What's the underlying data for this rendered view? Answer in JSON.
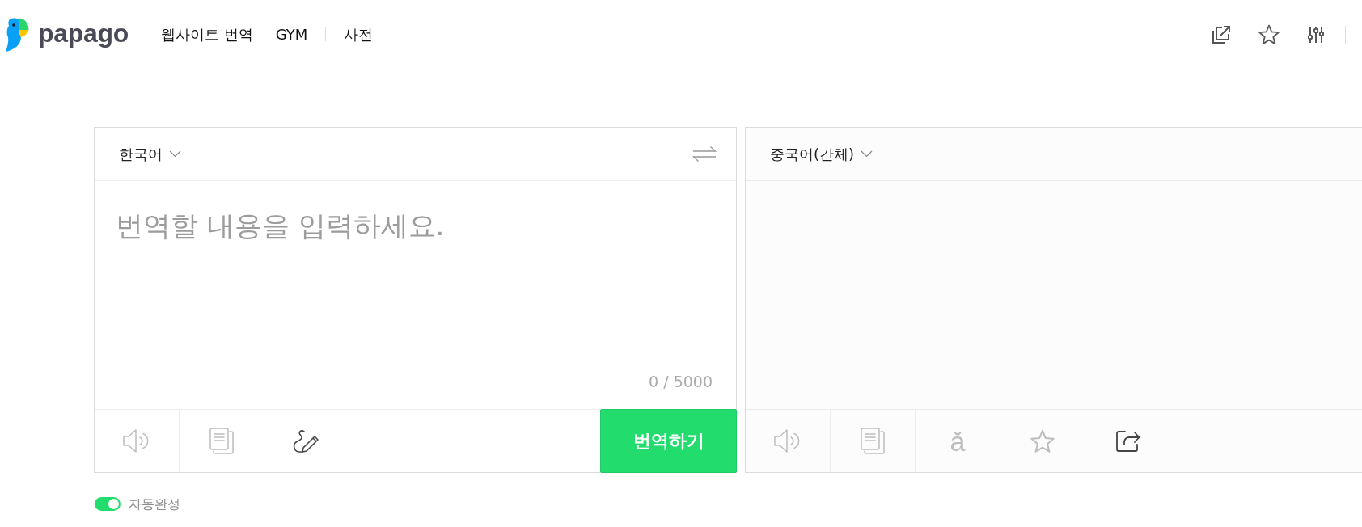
{
  "header": {
    "logo_text": "papago",
    "nav": [
      [
        {
          "label": "웹사이트 번역"
        },
        {
          "label": "GYM"
        }
      ],
      [
        {
          "label": "사전"
        }
      ]
    ]
  },
  "source": {
    "language": "한국어",
    "placeholder": "번역할 내용을 입력하세요.",
    "counter": "0 / 5000",
    "tools": [
      {
        "kind": "speaker",
        "disabled": true
      },
      {
        "kind": "copy",
        "disabled": true
      },
      {
        "kind": "handwriting",
        "disabled": false
      }
    ],
    "translate_button": "번역하기"
  },
  "target": {
    "language": "중국어(간체)",
    "tools": [
      {
        "kind": "speaker",
        "disabled": true
      },
      {
        "kind": "copy",
        "disabled": true
      },
      {
        "kind": "pinyin",
        "label": "ǎ",
        "disabled": true
      },
      {
        "kind": "star",
        "disabled": true
      },
      {
        "kind": "share",
        "disabled": false
      }
    ]
  },
  "autocomplete": {
    "label": "자동완성",
    "on": true
  }
}
